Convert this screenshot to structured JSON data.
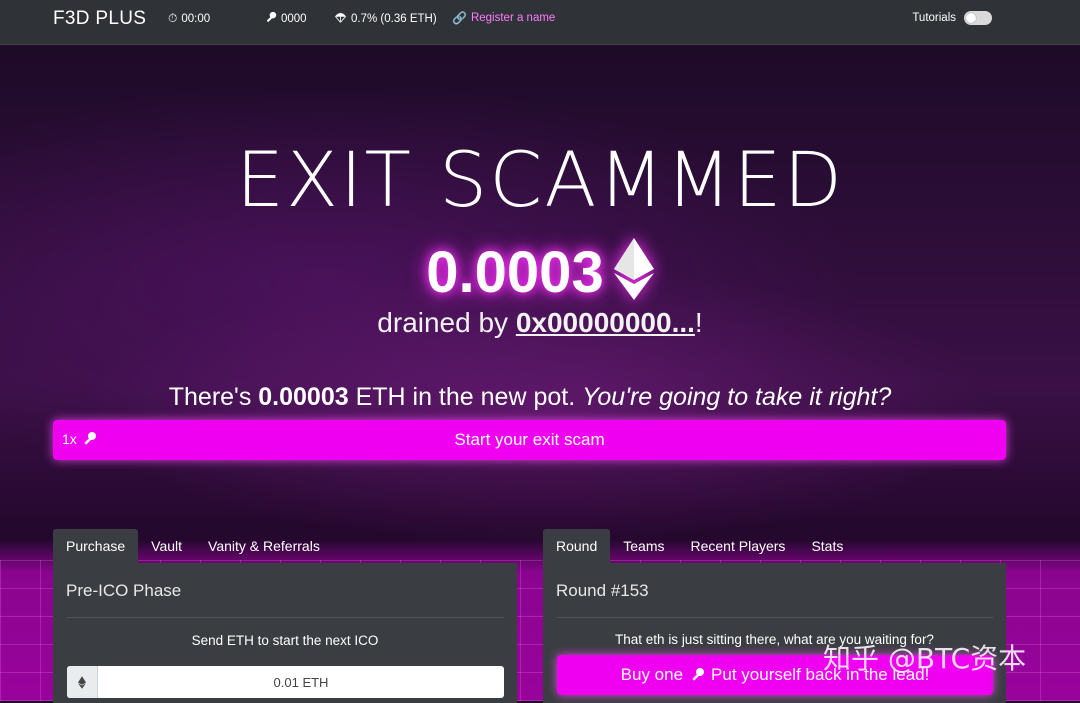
{
  "nav": {
    "brand": "F3D PLUS",
    "timer": "00:00",
    "keys": "0000",
    "airdrop": "0.7% (0.36 ETH)",
    "register": "Register a name",
    "tutorials": "Tutorials"
  },
  "hero": {
    "title": "EXIT SCAMMED",
    "amount": "0.0003",
    "drained_prefix": "drained by ",
    "drained_addr": "0x00000000...",
    "drained_suffix": "!",
    "pot_pre": "There's ",
    "pot_amount": "0.00003",
    "pot_mid": " ETH in the new pot. ",
    "pot_italic": "You're going to take it right?"
  },
  "exit_button": {
    "qty": "1x",
    "label": "Start your exit scam"
  },
  "left_panel": {
    "tabs": [
      "Purchase",
      "Vault",
      "Vanity & Referrals"
    ],
    "active_tab": "Purchase",
    "title": "Pre-ICO Phase",
    "subtitle": "Send ETH to start the next ICO",
    "eth_value": "0.01 ETH"
  },
  "right_panel": {
    "tabs": [
      "Round",
      "Teams",
      "Recent Players",
      "Stats"
    ],
    "active_tab": "Round",
    "title": "Round #153",
    "subtitle": "That eth is just sitting there, what are you waiting for?",
    "buy_pre": "Buy one",
    "buy_post": "Put yourself back in the lead!"
  },
  "watermark": "知乎 @BTC资本",
  "colors": {
    "accent": "#f000f0",
    "nav_bg": "#2f3236",
    "panel_bg": "#3a3d42",
    "link": "#ff7bff"
  }
}
